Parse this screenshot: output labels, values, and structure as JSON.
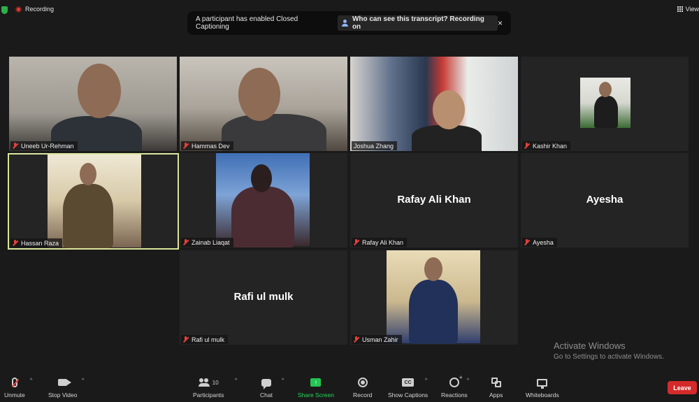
{
  "topbar": {
    "recording_label": "Recording",
    "view_label": "View"
  },
  "banner": {
    "message": "A participant has enabled Closed Captioning",
    "link_label": "Who can see this transcript? Recording on",
    "close_glyph": "×"
  },
  "participants": [
    {
      "name": "Uneeb Ur-Rehman",
      "video": true,
      "muted": true
    },
    {
      "name": "Hammas Dev",
      "video": true,
      "muted": true
    },
    {
      "name": "Joshua Zhang",
      "video": true,
      "muted": false
    },
    {
      "name": "Kashir Khan",
      "video": true,
      "muted": true
    },
    {
      "name": "Hassan Raza",
      "video": true,
      "muted": true,
      "active_speaker": true
    },
    {
      "name": "Zainab Liaqat",
      "video": true,
      "muted": true
    },
    {
      "name": "Rafay Ali Khan",
      "video": false,
      "muted": true,
      "center_name": "Rafay Ali Khan"
    },
    {
      "name": "Ayesha",
      "video": false,
      "muted": true,
      "center_name": "Ayesha"
    },
    {
      "name": "Rafi ul mulk",
      "video": false,
      "muted": true,
      "center_name": "Rafi ul mulk"
    },
    {
      "name": "Usman Zahir",
      "video": true,
      "muted": true
    }
  ],
  "watermark": {
    "title": "Activate Windows",
    "subtitle": "Go to Settings to activate Windows."
  },
  "toolbar": {
    "unmute": "Unmute",
    "stop_video": "Stop Video",
    "participants": "Participants",
    "participants_count": "10",
    "chat": "Chat",
    "share_screen": "Share Screen",
    "record": "Record",
    "show_captions": "Show Captions",
    "cc_glyph": "CC",
    "reactions": "Reactions",
    "apps": "Apps",
    "whiteboards": "Whiteboards",
    "leave": "Leave",
    "caret_glyph": "^",
    "share_glyph": "↑"
  },
  "colors": {
    "background": "#1a1a1a",
    "tile": "#242424",
    "active_border": "#dbe59a",
    "muted_red": "#e8413a",
    "share_green": "#23c552",
    "leave_red": "#d42a2a"
  }
}
